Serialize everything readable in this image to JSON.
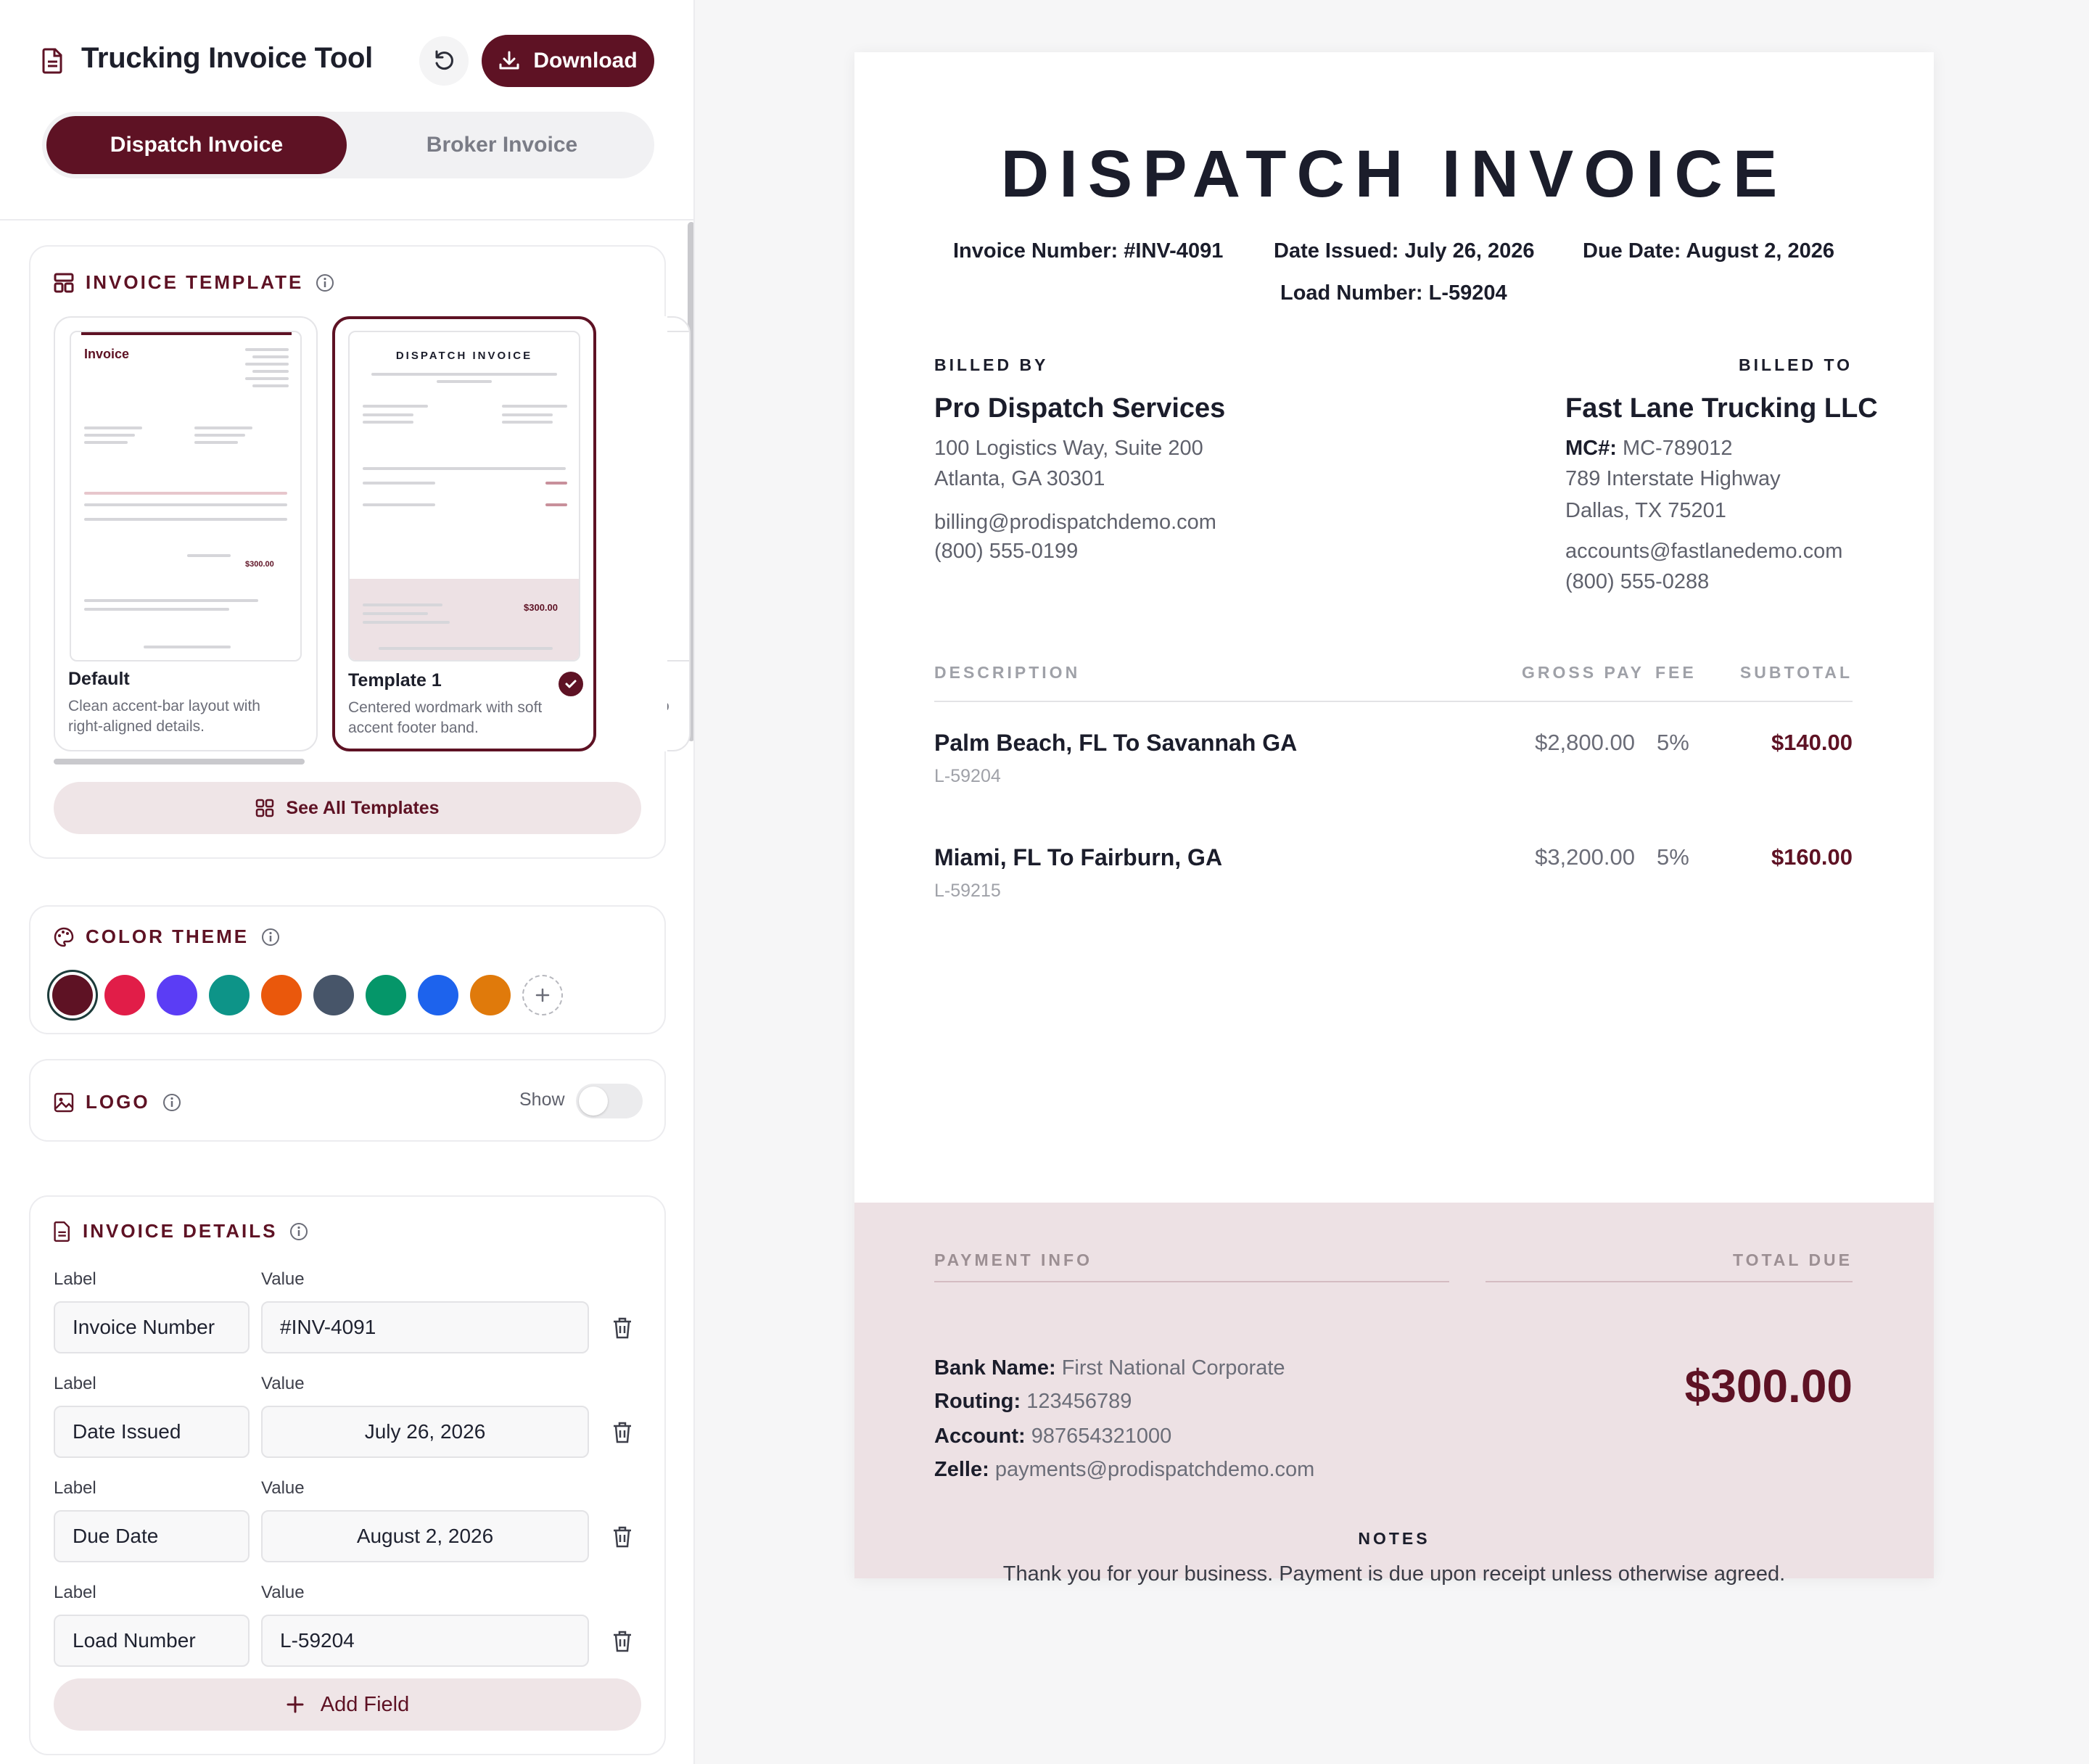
{
  "app": {
    "title": "Trucking Invoice Tool",
    "download_label": "Download",
    "tabs": [
      "Dispatch Invoice",
      "Broker Invoice"
    ],
    "accent_color": "#5e1224"
  },
  "template_section": {
    "heading": "INVOICE TEMPLATE",
    "templates": [
      {
        "name": "Default",
        "description": "Clean accent-bar layout with right-aligned details.",
        "preview_title": "Invoice",
        "preview_total": "$300.00"
      },
      {
        "name": "Template 1",
        "description": "Centered wordmark with soft accent footer band.",
        "preview_title": "DISPATCH INVOICE",
        "preview_total": "$300.00",
        "selected": true
      },
      {
        "name": "Te",
        "description": "Bo foo"
      }
    ],
    "see_all_label": "See All Templates"
  },
  "color_section": {
    "heading": "COLOR THEME",
    "swatches": [
      "#5e1224",
      "#e11d48",
      "#5b3df5",
      "#0d9488",
      "#ea580c",
      "#475569",
      "#059669",
      "#1d63ed",
      "#e07a0b"
    ],
    "selected": "#5e1224"
  },
  "logo_section": {
    "heading": "LOGO",
    "toggle_label": "Show",
    "enabled": false
  },
  "details_section": {
    "heading": "INVOICE DETAILS",
    "label_caption": "Label",
    "value_caption": "Value",
    "fields": [
      {
        "label": "Invoice Number",
        "value": "#INV-4091"
      },
      {
        "label": "Date Issued",
        "value": "July 26, 2026"
      },
      {
        "label": "Due Date",
        "value": "August 2, 2026"
      },
      {
        "label": "Load Number",
        "value": "L-59204"
      }
    ],
    "add_field_label": "Add Field"
  },
  "invoice": {
    "title": "DISPATCH INVOICE",
    "meta": [
      {
        "label": "Invoice Number:",
        "value": "#INV-4091"
      },
      {
        "label": "Date Issued:",
        "value": "July 26, 2026"
      },
      {
        "label": "Due Date:",
        "value": "August 2, 2026"
      },
      {
        "label": "Load Number:",
        "value": "L-59204"
      }
    ],
    "billed_by": {
      "heading": "BILLED BY",
      "name": "Pro Dispatch Services",
      "address1": "100 Logistics Way, Suite 200",
      "address2": "Atlanta, GA 30301",
      "email": "billing@prodispatchdemo.com",
      "phone": "(800) 555-0199"
    },
    "billed_to": {
      "heading": "BILLED TO",
      "name": "Fast Lane Trucking LLC",
      "mc_label": "MC#:",
      "mc_value": "MC-789012",
      "address1": "789 Interstate Highway",
      "address2": "Dallas, TX 75201",
      "email": "accounts@fastlanedemo.com",
      "phone": "(800) 555-0288"
    },
    "columns": [
      "DESCRIPTION",
      "GROSS PAY",
      "FEE",
      "SUBTOTAL"
    ],
    "items": [
      {
        "description": "Palm Beach, FL To Savannah GA",
        "load": "L-59204",
        "gross": "$2,800.00",
        "fee": "5%",
        "subtotal": "$140.00"
      },
      {
        "description": "Miami, FL To Fairburn, GA",
        "load": "L-59215",
        "gross": "$3,200.00",
        "fee": "5%",
        "subtotal": "$160.00"
      }
    ],
    "payment": {
      "heading": "PAYMENT INFO",
      "bank_label": "Bank Name:",
      "bank_value": "First National Corporate",
      "routing_label": "Routing:",
      "routing_value": "123456789",
      "account_label": "Account:",
      "account_value": "987654321000",
      "zelle_label": "Zelle:",
      "zelle_value": "payments@prodispatchdemo.com"
    },
    "total_heading": "TOTAL DUE",
    "total": "$300.00",
    "notes_heading": "NOTES",
    "notes": "Thank you for your business. Payment is due upon receipt unless otherwise agreed."
  }
}
